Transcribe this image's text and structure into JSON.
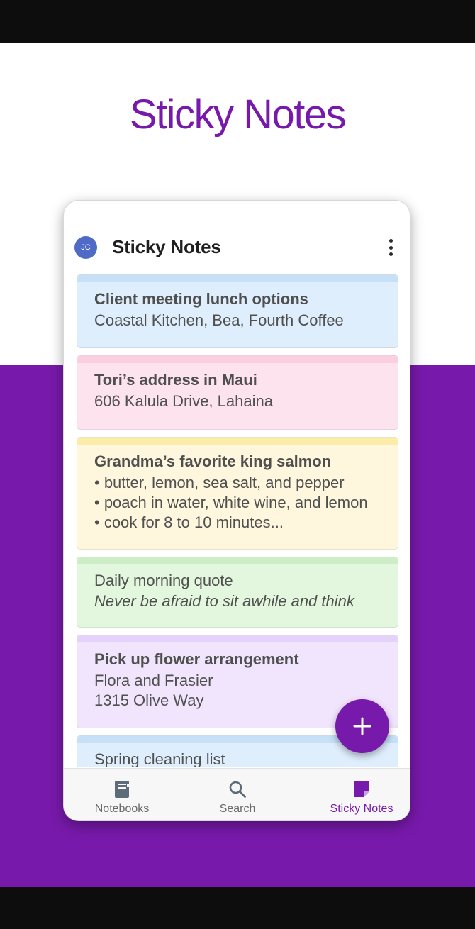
{
  "hero": {
    "title": "Sticky Notes"
  },
  "app": {
    "avatar_initials": "JC",
    "title": "Sticky Notes"
  },
  "notes": [
    {
      "title": "Client meeting lunch options",
      "lines": [
        "Coastal Kitchen, Bea, Fourth Coffee"
      ]
    },
    {
      "title": "Tori’s address in Maui",
      "lines": [
        "606 Kalula Drive, Lahaina"
      ]
    },
    {
      "title": "Grandma’s favorite king salmon",
      "lines": [
        "• butter, lemon, sea salt, and pepper",
        "• poach in water, white wine, and lemon",
        "• cook for 8 to 10 minutes..."
      ]
    },
    {
      "title": "Daily morning quote",
      "lines": [
        "Never be afraid to sit awhile and think"
      ]
    },
    {
      "title": "Pick up flower arrangement",
      "lines": [
        "Flora and Frasier",
        "1315 Olive Way"
      ]
    },
    {
      "title": "Spring cleaning list",
      "lines": []
    }
  ],
  "fab": {
    "icon": "plus-icon"
  },
  "bottom_nav": {
    "notebooks": {
      "label": "Notebooks",
      "icon": "notebook-icon"
    },
    "search": {
      "label": "Search",
      "icon": "search-icon"
    },
    "sticky_notes": {
      "label": "Sticky Notes",
      "icon": "sticky-note-icon"
    }
  },
  "colors": {
    "brand_purple": "#7719aa",
    "avatar_blue": "#4f6bc6"
  }
}
